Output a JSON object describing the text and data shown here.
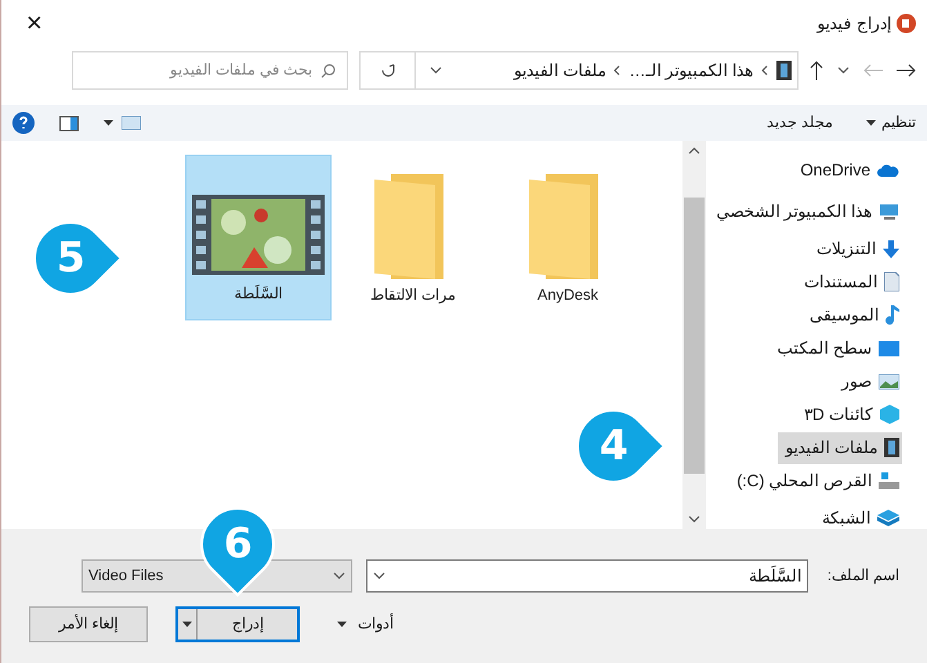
{
  "window": {
    "title": "إدراج فيديو",
    "close": "×"
  },
  "address": {
    "crumbs": [
      "هذا الكمبيوتر الـ…",
      "ملفات الفيديو"
    ]
  },
  "search": {
    "placeholder": "بحث في ملفات الفيديو"
  },
  "commands": [
    {
      "label": "تنظيم",
      "dropdown": true
    },
    {
      "label": "مجلد جديد",
      "dropdown": false
    }
  ],
  "sidebar": {
    "items": [
      {
        "label": "OneDrive",
        "selected": false
      },
      {
        "label": "هذا الكمبيوتر الشخصي",
        "selected": false,
        "children": [
          {
            "label": "التنزيلات",
            "selected": false
          },
          {
            "label": "المستندات",
            "selected": false
          },
          {
            "label": "الموسيقى",
            "selected": false
          },
          {
            "label": "سطح المكتب",
            "selected": false
          },
          {
            "label": "صور",
            "selected": false
          },
          {
            "label": "كائنات ٣D",
            "selected": false
          },
          {
            "label": "ملفات الفيديو",
            "selected": true,
            "callout": "4"
          },
          {
            "label": "القرص المحلي (C:)",
            "selected": false
          }
        ]
      },
      {
        "label": "الشبكة",
        "selected": false
      }
    ]
  },
  "files": [
    {
      "name": "AnyDesk",
      "kind": "folder",
      "selected": false
    },
    {
      "name": "مرات الالتقاط",
      "kind": "folder",
      "selected": false
    },
    {
      "name": "السَّلَطة",
      "kind": "video",
      "selected": true,
      "callout": "5"
    }
  ],
  "footer": {
    "filename_label": "اسم الملف:",
    "filename": "السَّلَطة",
    "filter": "Video Files",
    "tools": "أدوات",
    "buttons": [
      {
        "label": "إدراج",
        "kind": "split",
        "callout": "6"
      },
      {
        "label": "إلغاء الأمر",
        "kind": "plain"
      }
    ]
  }
}
